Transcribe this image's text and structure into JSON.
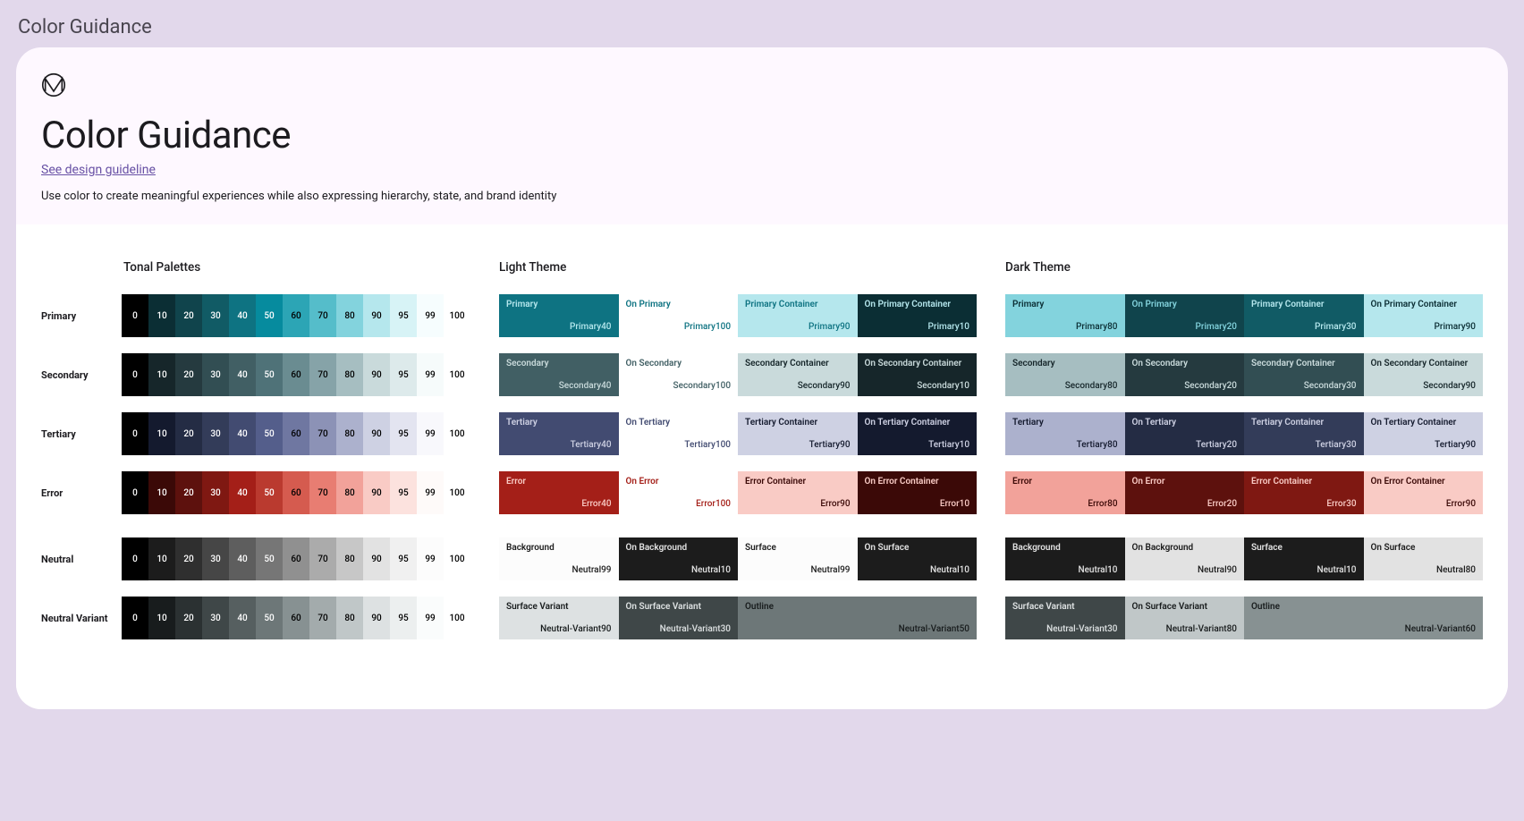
{
  "outer_title": "Color Guidance",
  "header": {
    "title": "Color Guidance",
    "link": "See design guideline",
    "subtitle": "Use color to create meaningful experiences while also expressing hierarchy, state, and brand identity"
  },
  "column_titles": {
    "tonal": "Tonal Palettes",
    "light": "Light Theme",
    "dark": "Dark Theme"
  },
  "tone_labels": [
    "0",
    "10",
    "20",
    "30",
    "40",
    "50",
    "60",
    "70",
    "80",
    "90",
    "95",
    "99",
    "100"
  ],
  "tone_text_colors": [
    "#fff",
    "#fff",
    "#fff",
    "#fff",
    "#fff",
    "#fff",
    "#000",
    "#000",
    "#000",
    "#000",
    "#000",
    "#000",
    "#000"
  ],
  "palettes": [
    {
      "name": "Primary",
      "colors": [
        "#000000",
        "#0B2E34",
        "#10444C",
        "#115B65",
        "#0E7382",
        "#068B9E",
        "#2CA5B5",
        "#55BDCA",
        "#83D3DD",
        "#B5E7ED",
        "#D7F3F6",
        "#F6FDFE",
        "#FFFFFF"
      ],
      "gap": false
    },
    {
      "name": "Secondary",
      "colors": [
        "#000000",
        "#16262A",
        "#253A3F",
        "#324E53",
        "#415F64",
        "#4F7278",
        "#6A8C91",
        "#86A3A8",
        "#A6BEC1",
        "#C9DADB",
        "#DDEAEB",
        "#F6FBFB",
        "#FFFFFF"
      ],
      "gap": false
    },
    {
      "name": "Tertiary",
      "colors": [
        "#000000",
        "#141A2E",
        "#242C44",
        "#333C59",
        "#424B71",
        "#545E8B",
        "#6F77A1",
        "#8C92B6",
        "#ACB1CD",
        "#CED1E3",
        "#E3E4F0",
        "#F8F8FC",
        "#FFFFFF"
      ],
      "gap": false
    },
    {
      "name": "Error",
      "colors": [
        "#000000",
        "#3B0907",
        "#5D110D",
        "#7F1812",
        "#A41F18",
        "#BA3A2F",
        "#D55B4F",
        "#E87D72",
        "#F2A29A",
        "#F9CBC5",
        "#FCE2DE",
        "#FEFAF9",
        "#FFFFFF"
      ],
      "gap": false
    },
    {
      "name": "Neutral",
      "colors": [
        "#000000",
        "#1C1C1C",
        "#2F2F2F",
        "#464646",
        "#5E5E5E",
        "#767676",
        "#909090",
        "#ABABAB",
        "#C7C7C7",
        "#E2E2E2",
        "#F0F0F0",
        "#FCFCFC",
        "#FFFFFF"
      ],
      "gap": true
    },
    {
      "name": "Neutral Variant",
      "colors": [
        "#000000",
        "#181C1D",
        "#2B3132",
        "#3F4748",
        "#565F60",
        "#6D7778",
        "#879192",
        "#A3ABAC",
        "#C0C7C8",
        "#DDE1E2",
        "#ECEFEF",
        "#FAFCFC",
        "#FFFFFF"
      ],
      "gap": false
    }
  ],
  "light_theme": [
    [
      {
        "name": "Primary",
        "tone": "Primary40",
        "bg": "#0E7382",
        "fg": "#B5E7ED"
      },
      {
        "name": "On Primary",
        "tone": "Primary100",
        "bg": "#FFFFFF",
        "fg": "#0E7382"
      },
      {
        "name": "Primary Container",
        "tone": "Primary90",
        "bg": "#B5E7ED",
        "fg": "#0E7382"
      },
      {
        "name": "On Primary Container",
        "tone": "Primary10",
        "bg": "#0B2E34",
        "fg": "#B5E7ED"
      }
    ],
    [
      {
        "name": "Secondary",
        "tone": "Secondary40",
        "bg": "#415F64",
        "fg": "#C9DADB"
      },
      {
        "name": "On Secondary",
        "tone": "Secondary100",
        "bg": "#FFFFFF",
        "fg": "#415F64"
      },
      {
        "name": "Secondary Container",
        "tone": "Secondary90",
        "bg": "#C9DADB",
        "fg": "#16262A"
      },
      {
        "name": "On Secondary Container",
        "tone": "Secondary10",
        "bg": "#16262A",
        "fg": "#C9DADB"
      }
    ],
    [
      {
        "name": "Tertiary",
        "tone": "Tertiary40",
        "bg": "#424B71",
        "fg": "#CED1E3"
      },
      {
        "name": "On Tertiary",
        "tone": "Tertiary100",
        "bg": "#FFFFFF",
        "fg": "#424B71"
      },
      {
        "name": "Tertiary Container",
        "tone": "Tertiary90",
        "bg": "#CED1E3",
        "fg": "#141A2E"
      },
      {
        "name": "On Tertiary Container",
        "tone": "Tertiary10",
        "bg": "#141A2E",
        "fg": "#CED1E3"
      }
    ],
    [
      {
        "name": "Error",
        "tone": "Error40",
        "bg": "#A41F18",
        "fg": "#F9CBC5"
      },
      {
        "name": "On Error",
        "tone": "Error100",
        "bg": "#FFFFFF",
        "fg": "#A41F18"
      },
      {
        "name": "Error Container",
        "tone": "Error90",
        "bg": "#F9CBC5",
        "fg": "#3B0907"
      },
      {
        "name": "On Error Container",
        "tone": "Error10",
        "bg": "#3B0907",
        "fg": "#F9CBC5"
      }
    ],
    [
      {
        "name": "Background",
        "tone": "Neutral99",
        "bg": "#FCFCFC",
        "fg": "#1C1C1C",
        "gap": true
      },
      {
        "name": "On Background",
        "tone": "Neutral10",
        "bg": "#1C1C1C",
        "fg": "#E2E2E2"
      },
      {
        "name": "Surface",
        "tone": "Neutral99",
        "bg": "#FCFCFC",
        "fg": "#1C1C1C"
      },
      {
        "name": "On Surface",
        "tone": "Neutral10",
        "bg": "#1C1C1C",
        "fg": "#E2E2E2"
      }
    ],
    [
      {
        "name": "Surface Variant",
        "tone": "Neutral-Variant90",
        "bg": "#DDE1E2",
        "fg": "#181C1D",
        "half": true
      },
      {
        "name": "On Surface Variant",
        "tone": "Neutral-Variant30",
        "bg": "#3F4748",
        "fg": "#DDE1E2"
      },
      {
        "name": "Outline",
        "tone": "Neutral-Variant50",
        "bg": "#6D7778",
        "fg": "#181C1D",
        "span": 2
      }
    ]
  ],
  "dark_theme": [
    [
      {
        "name": "Primary",
        "tone": "Primary80",
        "bg": "#83D3DD",
        "fg": "#0B2E34"
      },
      {
        "name": "On Primary",
        "tone": "Primary20",
        "bg": "#10444C",
        "fg": "#83D3DD"
      },
      {
        "name": "Primary Container",
        "tone": "Primary30",
        "bg": "#115B65",
        "fg": "#B5E7ED"
      },
      {
        "name": "On Primary Container",
        "tone": "Primary90",
        "bg": "#B5E7ED",
        "fg": "#0B2E34"
      }
    ],
    [
      {
        "name": "Secondary",
        "tone": "Secondary80",
        "bg": "#A6BEC1",
        "fg": "#16262A"
      },
      {
        "name": "On Secondary",
        "tone": "Secondary20",
        "bg": "#253A3F",
        "fg": "#C9DADB"
      },
      {
        "name": "Secondary Container",
        "tone": "Secondary30",
        "bg": "#324E53",
        "fg": "#C9DADB"
      },
      {
        "name": "On Secondary Container",
        "tone": "Secondary90",
        "bg": "#C9DADB",
        "fg": "#16262A"
      }
    ],
    [
      {
        "name": "Tertiary",
        "tone": "Tertiary80",
        "bg": "#ACB1CD",
        "fg": "#141A2E"
      },
      {
        "name": "On Tertiary",
        "tone": "Tertiary20",
        "bg": "#242C44",
        "fg": "#CED1E3"
      },
      {
        "name": "Tertiary Container",
        "tone": "Tertiary30",
        "bg": "#333C59",
        "fg": "#CED1E3"
      },
      {
        "name": "On Tertiary Container",
        "tone": "Tertiary90",
        "bg": "#CED1E3",
        "fg": "#141A2E"
      }
    ],
    [
      {
        "name": "Error",
        "tone": "Error80",
        "bg": "#F2A29A",
        "fg": "#3B0907"
      },
      {
        "name": "On Error",
        "tone": "Error20",
        "bg": "#5D110D",
        "fg": "#F9CBC5"
      },
      {
        "name": "Error Container",
        "tone": "Error30",
        "bg": "#7F1812",
        "fg": "#F9CBC5"
      },
      {
        "name": "On Error Container",
        "tone": "Error90",
        "bg": "#F9CBC5",
        "fg": "#3B0907"
      }
    ],
    [
      {
        "name": "Background",
        "tone": "Neutral10",
        "bg": "#1C1C1C",
        "fg": "#E2E2E2",
        "gap": true
      },
      {
        "name": "On Background",
        "tone": "Neutral90",
        "bg": "#E2E2E2",
        "fg": "#1C1C1C"
      },
      {
        "name": "Surface",
        "tone": "Neutral10",
        "bg": "#1C1C1C",
        "fg": "#E2E2E2"
      },
      {
        "name": "On Surface",
        "tone": "Neutral80",
        "bg": "#E2E2E2",
        "fg": "#1C1C1C"
      }
    ],
    [
      {
        "name": "Surface Variant",
        "tone": "Neutral-Variant30",
        "bg": "#3F4748",
        "fg": "#DDE1E2",
        "half": true
      },
      {
        "name": "On Surface Variant",
        "tone": "Neutral-Variant80",
        "bg": "#C0C7C8",
        "fg": "#181C1D"
      },
      {
        "name": "Outline",
        "tone": "Neutral-Variant60",
        "bg": "#879192",
        "fg": "#181C1D",
        "span": 2
      }
    ]
  ]
}
